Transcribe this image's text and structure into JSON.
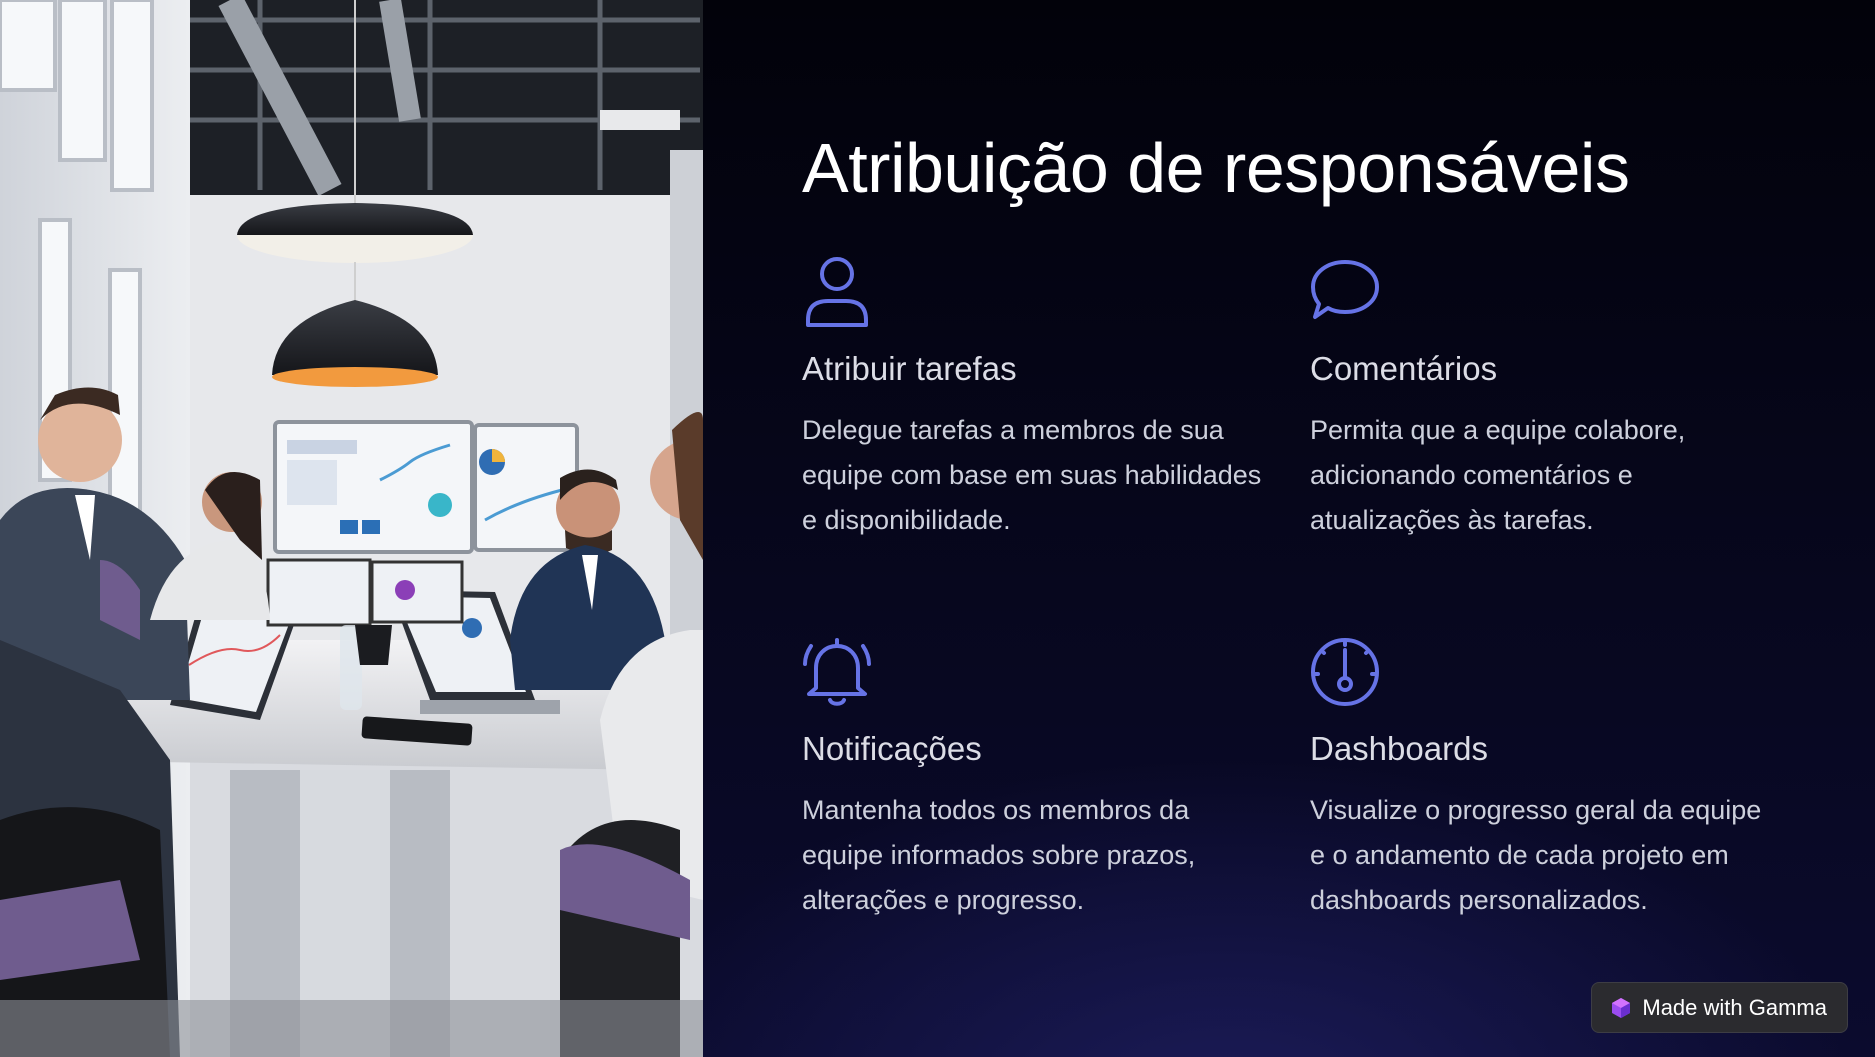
{
  "slide": {
    "title": "Atribuição de responsáveis",
    "features": [
      {
        "icon": "user-icon",
        "title": "Atribuir tarefas",
        "description": "Delegue tarefas a membros de sua equipe com base em suas habilidades e disponibilidade."
      },
      {
        "icon": "chat-bubble-icon",
        "title": "Comentários",
        "description": "Permita que a equipe colabore, adicionando comentários e atualizações às tarefas."
      },
      {
        "icon": "bell-icon",
        "title": "Notificações",
        "description": "Mantenha todos os membros da equipe informados sobre prazos, alterações e progresso."
      },
      {
        "icon": "gauge-icon",
        "title": "Dashboards",
        "description": "Visualize o progresso geral da equipe e o andamento de cada projeto em dashboards personalizados."
      }
    ]
  },
  "badge": {
    "label": "Made with Gamma",
    "icon": "gamma-logo-icon"
  },
  "colors": {
    "icon_accent": "#6673e6",
    "panel_background": "#03030f",
    "title_text": "#ffffff"
  },
  "photo": {
    "subject": "office-meeting-photo"
  }
}
